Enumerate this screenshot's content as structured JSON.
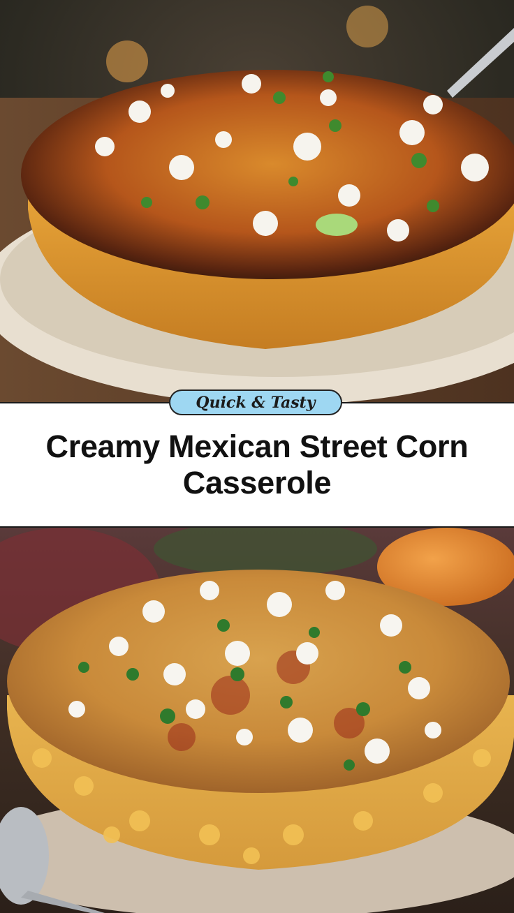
{
  "badge": {
    "label": "Quick & Tasty"
  },
  "title": {
    "line1": "Creamy Mexican Street Corn",
    "line2": "Casserole"
  },
  "images": {
    "top": "corn-casserole-photo-top",
    "bottom": "corn-casserole-photo-bottom"
  },
  "colors": {
    "badge_bg": "#9ed7f2",
    "title_text": "#111111",
    "band_bg": "#ffffff"
  }
}
